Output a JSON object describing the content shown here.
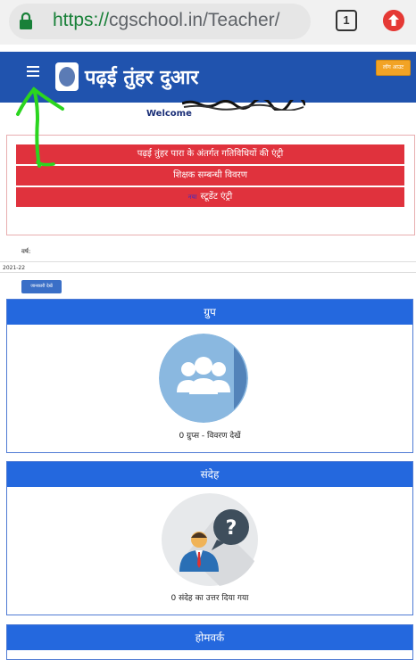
{
  "browser": {
    "url_scheme": "https://",
    "url_rest": "cgschool.in/Teacher/",
    "tab_count": "1"
  },
  "header": {
    "title": "पढ़ई तुंहर दुआर",
    "logout_label": "लॉग आउट",
    "welcome": "Welcome"
  },
  "menu": {
    "items": [
      "पढ़ई तुंहर पारा के अंतर्गत गतिविधियों की एंट्री",
      "शिक्षक सम्बन्धी विवरण",
      "स्टूडेंट एंट्री"
    ],
    "student_prefix": "नया"
  },
  "filter": {
    "year_label": "वर्ष:",
    "year_value": "2021-22",
    "view_button": "जानकारी देखें"
  },
  "panels": {
    "groups": {
      "title": "ग्रुप",
      "caption": "0 ग्रुप्स - विवरण देखें"
    },
    "messages": {
      "title": "संदेह",
      "caption": "0 संदेह का उत्तर दिया गया"
    },
    "homework": {
      "title": "होमवर्क"
    }
  },
  "colors": {
    "appbar": "#2053ae",
    "red_button": "#e0323d",
    "panel_header": "#2468de",
    "logout": "#f2a325"
  }
}
